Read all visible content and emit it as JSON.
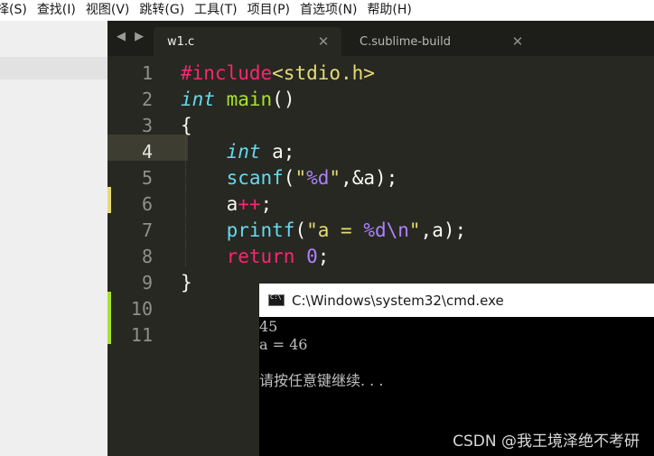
{
  "menu": {
    "items": [
      "择(S)",
      "查找(I)",
      "视图(V)",
      "跳转(G)",
      "工具(T)",
      "项目(P)",
      "首选项(N)",
      "帮助(H)"
    ]
  },
  "tabs": {
    "nav_arrows": "◀ ▶",
    "active_label": "w1.c",
    "inactive_label": "C.sublime-build",
    "close_glyph": "✕"
  },
  "editor": {
    "line_numbers": [
      "1",
      "2",
      "3",
      "4",
      "5",
      "6",
      "7",
      "8",
      "9",
      "10",
      "11"
    ],
    "current_line": 4,
    "code_lines": [
      "#include<stdio.h>",
      "int main()",
      "{",
      "    int a;",
      "    scanf(\"%d\",&a);",
      "    a++;",
      "    printf(\"a = %d\\n\",a);",
      "    return 0;",
      "}",
      "",
      ""
    ]
  },
  "console": {
    "title": "C:\\Windows\\system32\\cmd.exe",
    "lines": [
      "45",
      "a = 46",
      "",
      "请按任意键继续. . ."
    ],
    "watermark": "CSDN @我王境泽绝不考研"
  },
  "colors": {
    "editor_bg": "#272822",
    "keyword": "#f92672",
    "type": "#66d9ef",
    "function": "#a6e22e",
    "string": "#e6db74",
    "number": "#ae81ff",
    "modified_marker": "#e6db74",
    "added_marker": "#a6e22e"
  }
}
